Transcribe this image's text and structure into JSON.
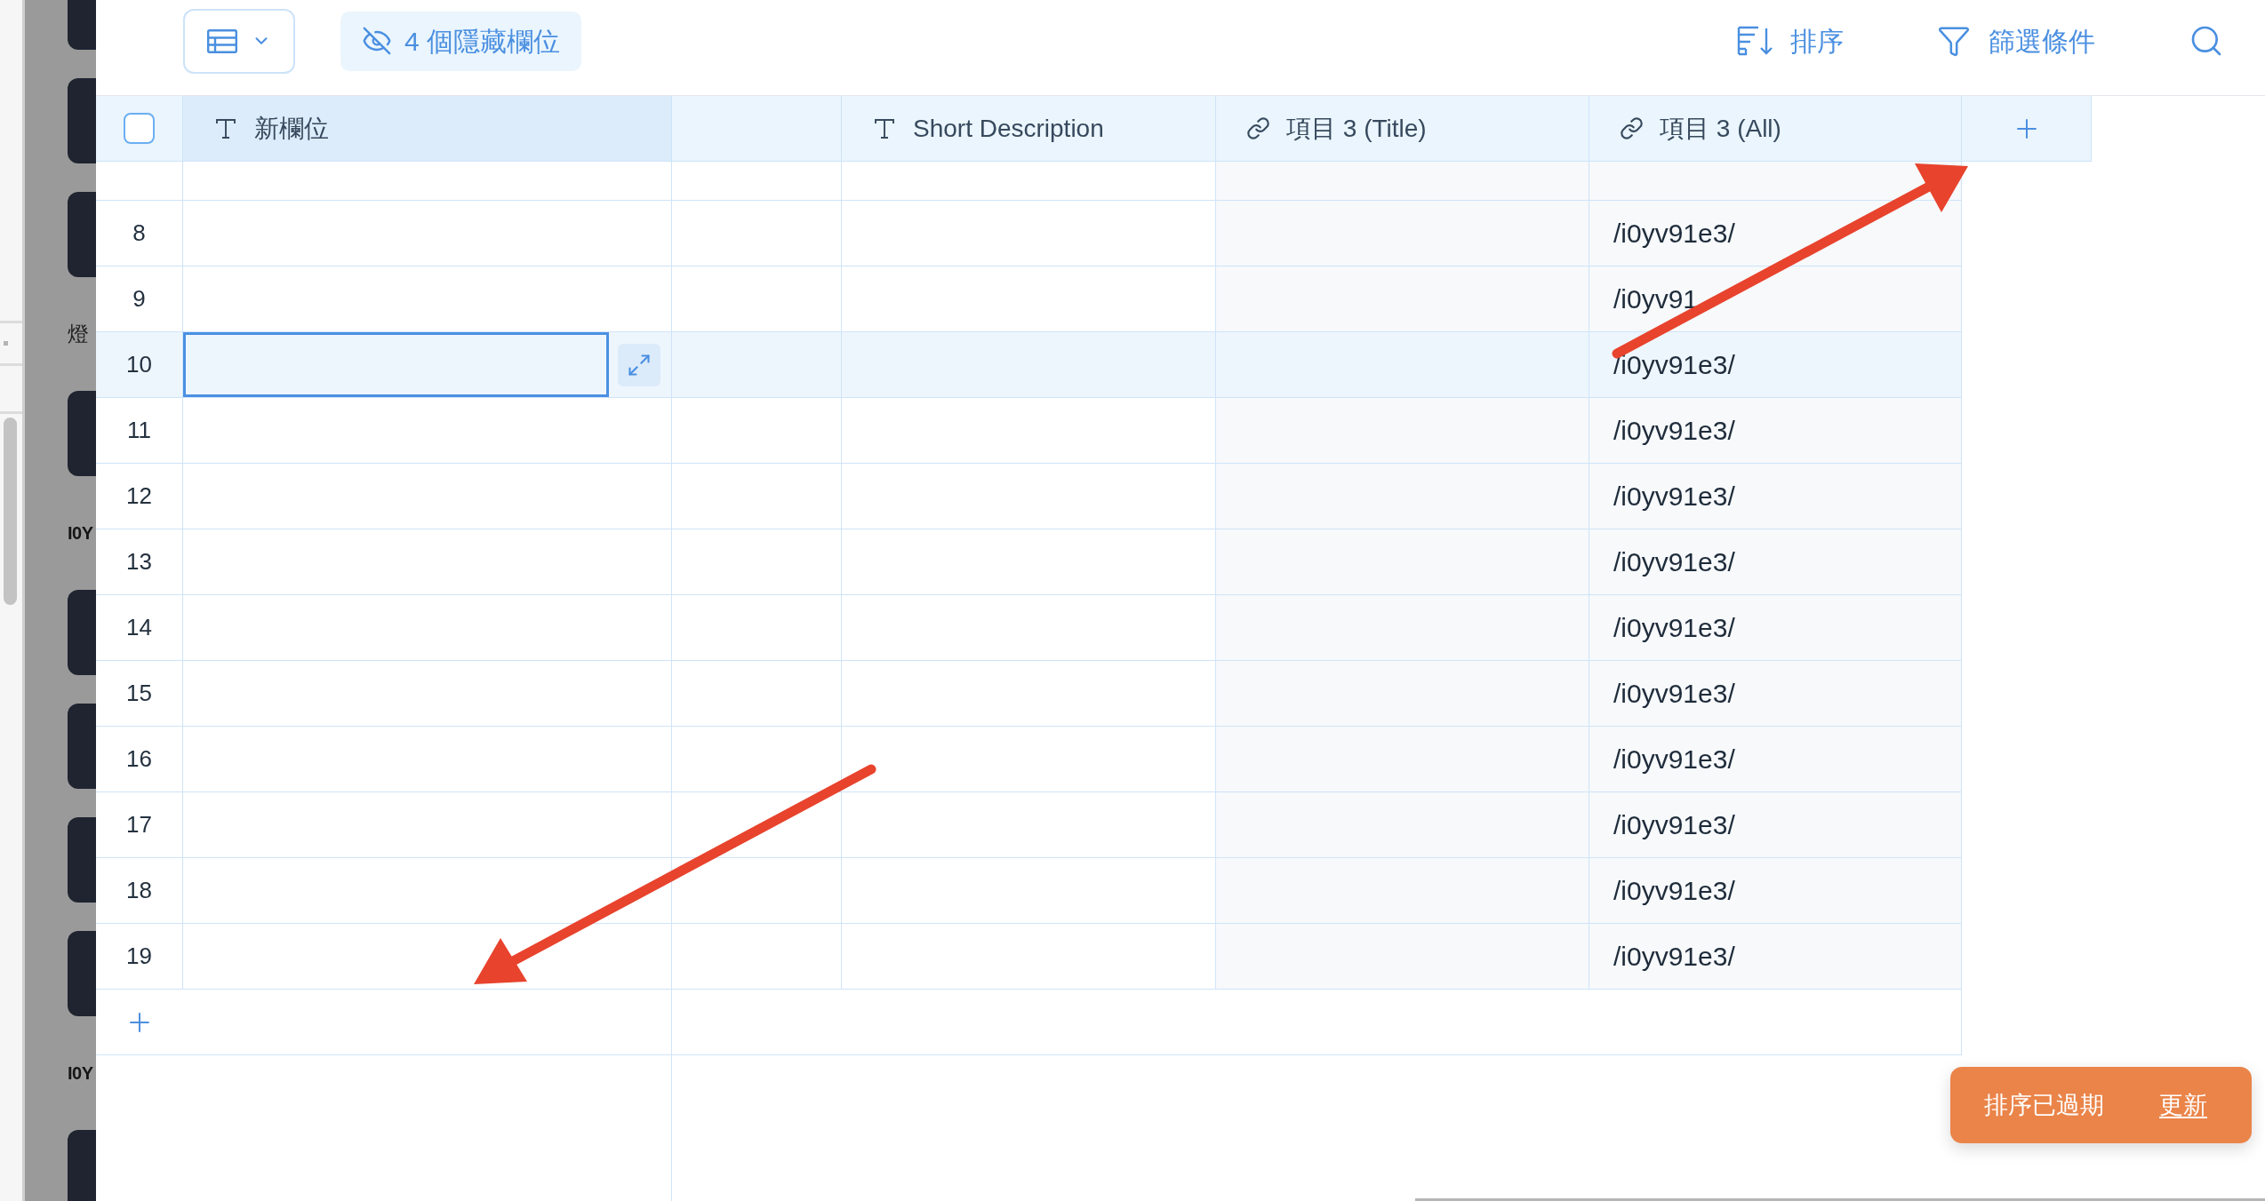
{
  "background_app": {
    "items": [
      {
        "kind": "card"
      },
      {
        "kind": "card"
      },
      {
        "kind": "card"
      },
      {
        "kind": "caption",
        "text": "燈"
      },
      {
        "kind": "card"
      },
      {
        "kind": "heading",
        "text": "I0Y"
      },
      {
        "kind": "card"
      },
      {
        "kind": "card"
      },
      {
        "kind": "card"
      },
      {
        "kind": "card"
      },
      {
        "kind": "heading",
        "text": "I0Y"
      },
      {
        "kind": "card"
      }
    ]
  },
  "toolbar": {
    "hidden_fields": {
      "label": "4 個隱藏欄位"
    },
    "actions": [
      {
        "kind": "sort",
        "label": "排序"
      },
      {
        "kind": "filter",
        "label": "篩選條件"
      },
      {
        "kind": "search"
      }
    ]
  },
  "table": {
    "select_all": {
      "checked": false
    },
    "columns": [
      {
        "kind": "text",
        "label": "新欄位",
        "selected": true
      },
      {
        "kind": "blank",
        "selected": false
      },
      {
        "kind": "text",
        "label": "Short Description",
        "selected": false
      },
      {
        "kind": "link",
        "label": "項目 3 (Title)",
        "selected": false
      },
      {
        "kind": "link",
        "label": "項目 3 (All)",
        "selected": false
      }
    ],
    "rows": [
      {
        "selected": false
      },
      {
        "number": "8",
        "item3_all": "/i0yv91e3/",
        "selected": false
      },
      {
        "number": "9",
        "item3_all": "/i0yv91",
        "selected": false
      },
      {
        "number": "10",
        "item3_all": "/i0yv91e3/",
        "selected": true
      },
      {
        "number": "11",
        "item3_all": "/i0yv91e3/",
        "selected": false
      },
      {
        "number": "12",
        "item3_all": "/i0yv91e3/",
        "selected": false
      },
      {
        "number": "13",
        "item3_all": "/i0yv91e3/",
        "selected": false
      },
      {
        "number": "14",
        "item3_all": "/i0yv91e3/",
        "selected": false
      },
      {
        "number": "15",
        "item3_all": "/i0yv91e3/",
        "selected": false
      },
      {
        "number": "16",
        "item3_all": "/i0yv91e3/",
        "selected": false
      },
      {
        "number": "17",
        "item3_all": "/i0yv91e3/",
        "selected": false
      },
      {
        "number": "18",
        "item3_all": "/i0yv91e3/",
        "selected": false
      },
      {
        "number": "19",
        "item3_all": "/i0yv91e3/",
        "selected": false
      }
    ]
  },
  "toast": {
    "message": "排序已過期",
    "action": "更新"
  }
}
